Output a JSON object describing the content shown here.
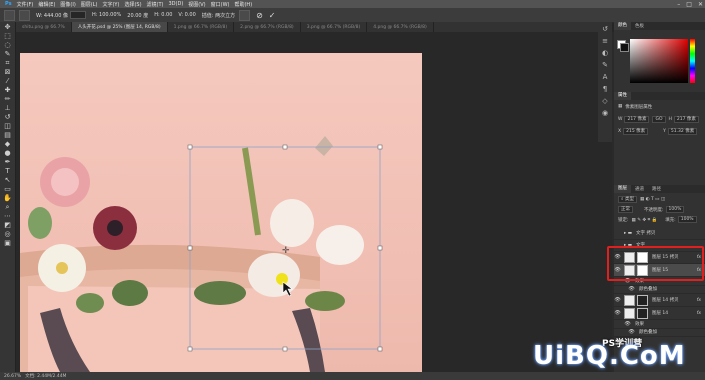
{
  "menu": [
    "文件(F)",
    "编辑(E)",
    "图像(I)",
    "图层(L)",
    "文字(Y)",
    "选择(S)",
    "滤镜(T)",
    "3D(D)",
    "视图(V)",
    "窗口(W)",
    "帮助(H)"
  ],
  "options": {
    "w_label": "W: 444.00 像",
    "h_label": "H: 100.00%",
    "angle": "20.00 度",
    "interp": "H: 0.00",
    "v": "V: 0.00",
    "mode": "插值: 两次立方"
  },
  "tabs": [
    "shitu.png @ 66.7%",
    "人头开花.psd @ 25% (图层 14, RGB/8)",
    "1.png @ 66.7% (RGB/8)",
    "2.png @ 66.7% (RGB/8)",
    "3.png @ 66.7% (RGB/8)",
    "4.png @ 66.7% (RGB/8)"
  ],
  "colors": {
    "highlight_box": "#e0201e",
    "artboard_bg": "#f5c9be"
  },
  "properties": {
    "header": "属性",
    "type_label": "像素图层属性",
    "w": "217 像素",
    "h": "217 像素",
    "x": "215 像素",
    "y": "51.32 像素",
    "go": "GO"
  },
  "color_panel": {
    "tabs": [
      "颜色",
      "色板"
    ]
  },
  "layers_panel": {
    "tabs": [
      "图层",
      "通道",
      "路径"
    ],
    "mode": "正常",
    "opacity_label": "不透明度:",
    "opacity": "100%",
    "lock_label": "锁定:",
    "fill_label": "填充:",
    "fill": "100%",
    "rows": [
      {
        "name": "文字 拷贝",
        "type": "group"
      },
      {
        "name": "文字",
        "type": "group"
      },
      {
        "name": "图层 15 拷贝",
        "fx": "fx"
      },
      {
        "name": "图层 15",
        "fx": "fx"
      },
      {
        "name": "效果",
        "type": "sub"
      },
      {
        "name": "颜色叠加",
        "type": "sub"
      },
      {
        "name": "图层 14 拷贝",
        "fx": "fx"
      },
      {
        "name": "图层 14",
        "fx": "fx"
      },
      {
        "name": "效果",
        "type": "sub"
      },
      {
        "name": "颜色叠加",
        "type": "sub"
      }
    ]
  },
  "status": {
    "zoom": "26.67%",
    "doc": "文档: 2.44M/2.44M"
  },
  "watermark": {
    "brand": "UiBQ.CoM",
    "sub": "PS学训营"
  }
}
